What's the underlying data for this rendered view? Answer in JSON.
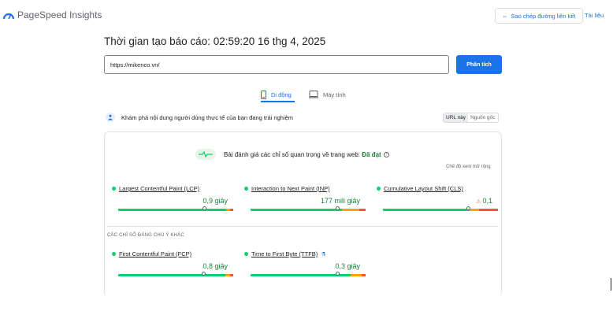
{
  "header": {
    "logo_text": "PageSpeed Insights",
    "copy_link_label": "Sao chép đường liên kết",
    "docs_label": "Tài liệu"
  },
  "report": {
    "time_label": "Thời gian tạo báo cáo: 02:59:20 16 thg 4, 2025"
  },
  "search": {
    "url_value": "https://mikenco.vn/",
    "analyze_label": "Phân tích"
  },
  "tabs": [
    {
      "label": "Di động",
      "active": true
    },
    {
      "label": "Máy tính",
      "active": false
    }
  ],
  "crux": {
    "text": "Khám phá nội dung người dùng thực tế của bạn đang trải nghiệm",
    "toggle": [
      "URL này",
      "Nguồn gốc"
    ]
  },
  "assessment": {
    "prefix": "Bài đánh giá các chỉ số quan trọng về trang web: ",
    "status": "Đã đạt",
    "expand_label": "Chế độ xem mở rộng"
  },
  "core_metrics": [
    {
      "name": "Largest Contentful Paint (LCP)",
      "value": "0,9 giây",
      "status": "good"
    },
    {
      "name": "Interaction to Next Paint (INP)",
      "value": "177 mili giây",
      "status": "good"
    },
    {
      "name": "Cumulative Layout Shift (CLS)",
      "value": "0,1",
      "status": "good",
      "warning": true
    }
  ],
  "other_title": "CÁC CHỈ SỐ ĐÁNG CHÚ Ý KHÁC",
  "other_metrics": [
    {
      "name": "First Contentful Paint (FCP)",
      "value": "0,8 giây",
      "status": "good"
    },
    {
      "name": "Time to First Byte (TTFB)",
      "value": "0,3 giây",
      "status": "good",
      "experimental": true
    }
  ],
  "colors": {
    "accent": "#1a73e8",
    "good": "#0cce6b",
    "average": "#ffa400",
    "poor": "#ff4e42",
    "pass_text": "#188038"
  }
}
